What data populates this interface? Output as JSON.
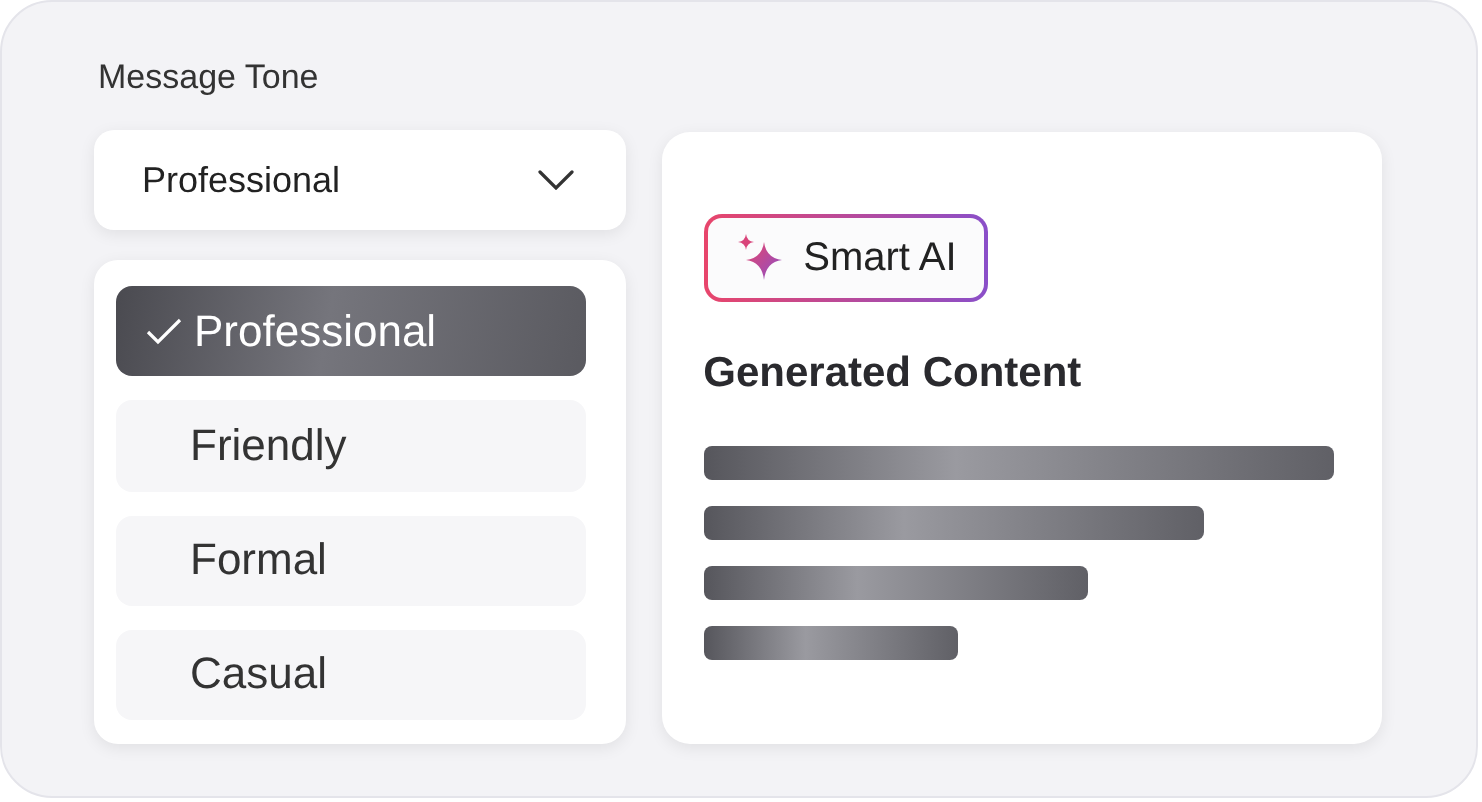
{
  "field_label": "Message Tone",
  "dropdown": {
    "value": "Professional",
    "expanded": true
  },
  "options": [
    {
      "label": "Professional",
      "selected": true
    },
    {
      "label": "Friendly",
      "selected": false
    },
    {
      "label": "Formal",
      "selected": false
    },
    {
      "label": "Casual",
      "selected": false
    }
  ],
  "badge": {
    "label": "Smart AI"
  },
  "heading": "Generated Content"
}
